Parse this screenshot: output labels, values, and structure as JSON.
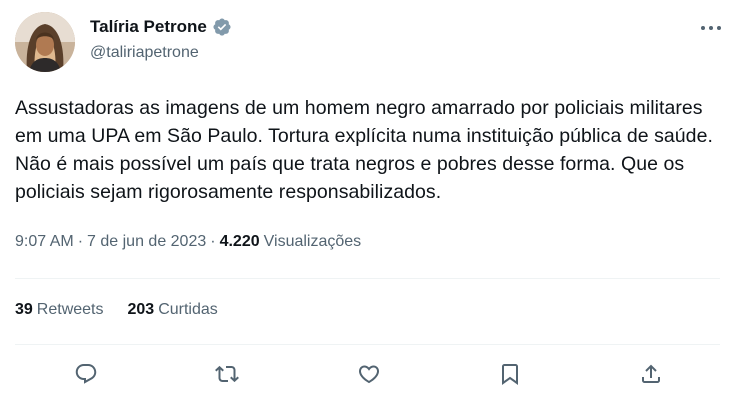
{
  "author": {
    "name": "Talíria Petrone",
    "handle": "@taliriapetrone",
    "verified": true
  },
  "tweet": {
    "text": "Assustadoras as imagens de um homem negro amarrado por policiais militares em uma UPA em São Paulo. Tortura explícita numa instituição pública de saúde. Não é mais possível um país que trata negros e pobres desse forma. Que os policiais sejam rigorosamente responsabilizados.",
    "time": "9:07 AM",
    "separator": "·",
    "date": "7 de jun de 2023",
    "views_count": "4.220",
    "views_label": "Visualizações"
  },
  "stats": {
    "retweets_count": "39",
    "retweets_label": "Retweets",
    "likes_count": "203",
    "likes_label": "Curtidas"
  },
  "icons": {
    "more": "more-dots-icon",
    "reply": "reply-icon",
    "retweet": "retweet-icon",
    "like": "heart-icon",
    "bookmark": "bookmark-icon",
    "share": "share-icon",
    "verified": "verified-badge-icon"
  },
  "colors": {
    "text_primary": "#0f1419",
    "text_secondary": "#536471",
    "divider": "#eff3f4",
    "verified_badge": "#829aab",
    "icon": "#536471"
  }
}
